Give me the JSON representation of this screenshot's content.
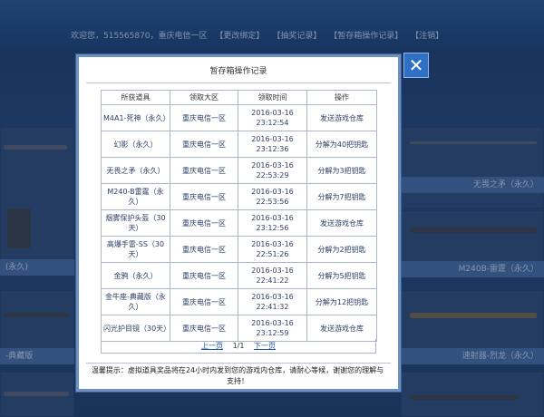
{
  "header": {
    "welcome": "欢迎您，515565870，重庆电信一区",
    "links": [
      "【更改绑定】",
      "【抽奖记录】",
      "【暂存箱操作记录】",
      "【注销】"
    ]
  },
  "background": {
    "bands": [
      "无畏之矛（永久）",
      "M240B-雷霆（永久）",
      "速射器-烈龙（永久）",
      "(永久)",
      "-典藏版"
    ]
  },
  "modal": {
    "title": "暂存箱操作记录",
    "close_label": "✕",
    "columns": [
      "所获道具",
      "领取大区",
      "领取时间",
      "操作"
    ],
    "rows": [
      {
        "item": "M4A1-死神（永久）",
        "region": "重庆电信一区",
        "date": "2016-03-16",
        "time": "23:12:54",
        "action": "发送游戏仓库"
      },
      {
        "item": "幻影（永久）",
        "region": "重庆电信一区",
        "date": "2016-03-16",
        "time": "23:12:36",
        "action": "分解为40把钥匙"
      },
      {
        "item": "无畏之矛（永久）",
        "region": "重庆电信一区",
        "date": "2016-03-16",
        "time": "22:53:29",
        "action": "分解为3把钥匙"
      },
      {
        "item": "M240-B雷霆（永久）",
        "region": "重庆电信一区",
        "date": "2016-03-16",
        "time": "22:53:56",
        "action": "分解为7把钥匙"
      },
      {
        "item": "烟雾保护头盔（30天）",
        "region": "重庆电信一区",
        "date": "2016-03-16",
        "time": "23:12:56",
        "action": "发送游戏仓库"
      },
      {
        "item": "高爆手雷-SS（30天）",
        "region": "重庆电信一区",
        "date": "2016-03-16",
        "time": "22:51:26",
        "action": "分解为2把钥匙"
      },
      {
        "item": "金鸦（永久）",
        "region": "重庆电信一区",
        "date": "2016-03-16",
        "time": "22:41:22",
        "action": "分解为5把钥匙"
      },
      {
        "item": "金牛座-典藏版（永久）",
        "region": "重庆电信一区",
        "date": "2016-03-16",
        "time": "22:41:32",
        "action": "分解为12把钥匙"
      },
      {
        "item": "闪光护目镜（30天）",
        "region": "重庆电信一区",
        "date": "2016-03-16",
        "time": "23:12:59",
        "action": "发送游戏仓库"
      }
    ],
    "pager": {
      "prev": "上一页",
      "page": "1/1",
      "next": "下一页"
    },
    "tip": "温馨提示：虚拟道具奖品将在24小时内发到您的游戏内仓库，请耐心等候，谢谢您的理解与支持！"
  }
}
